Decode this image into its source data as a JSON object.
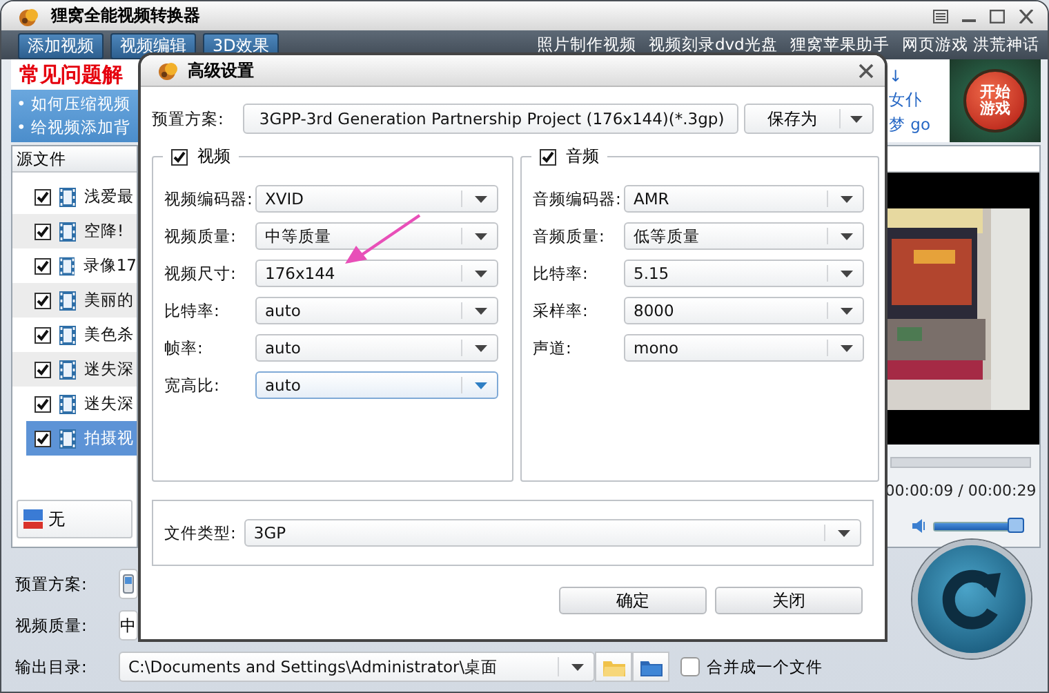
{
  "app": {
    "title": "狸窝全能视频转换器"
  },
  "toolbar": {
    "buttons": [
      "添加视频",
      "视频编辑",
      "3D效果"
    ],
    "links": [
      "照片制作视频",
      "视频刻录dvd光盘",
      "狸窝苹果助手",
      "网页游戏 洪荒神话"
    ]
  },
  "banner": {
    "heading": "常见问题解",
    "lines": [
      "• 如何压缩视频",
      "• 给视频添加背"
    ],
    "side_lines": [
      "↓",
      "女仆",
      "梦 go"
    ],
    "game_badge": "开始游戏"
  },
  "file_list": {
    "header": "源文件",
    "files": [
      {
        "name": "浅爱最",
        "checked": true,
        "selected": false
      },
      {
        "name": "空降!",
        "checked": true,
        "selected": false
      },
      {
        "name": "录像17",
        "checked": true,
        "selected": false
      },
      {
        "name": "美丽的",
        "checked": true,
        "selected": false
      },
      {
        "name": "美色杀",
        "checked": true,
        "selected": false
      },
      {
        "name": "迷失深",
        "checked": true,
        "selected": false
      },
      {
        "name": "迷失深",
        "checked": true,
        "selected": false
      },
      {
        "name": "拍摄视",
        "checked": true,
        "selected": true
      }
    ]
  },
  "subtitle": {
    "value": "无"
  },
  "preview": {
    "progress": {
      "level": 0
    },
    "time": "00:00:09 / 00:00:29",
    "volume": {
      "level": 0.92
    }
  },
  "output": {
    "preset_label": "预置方案:",
    "quality_label": "视频质量:",
    "quality_value": "中",
    "dir_label": "输出目录:",
    "dir_value": "C:\\Documents and Settings\\Administrator\\桌面",
    "merge": {
      "label": "合并成一个文件",
      "checked": false
    }
  },
  "dialog": {
    "title": "高级设置",
    "preset_label": "预置方案:",
    "preset_value": "3GPP-3rd Generation Partnership Project (176x144)(*.3gp)",
    "save_as": "保存为",
    "video": {
      "title": "视频",
      "checked": true,
      "fields": [
        {
          "label": "视频编码器:",
          "value": "XVID",
          "focused": false
        },
        {
          "label": "视频质量:",
          "value": "中等质量",
          "focused": false
        },
        {
          "label": "视频尺寸:",
          "value": "176x144",
          "focused": false
        },
        {
          "label": "比特率:",
          "value": "auto",
          "focused": false
        },
        {
          "label": "帧率:",
          "value": "auto",
          "focused": false
        },
        {
          "label": "宽高比:",
          "value": "auto",
          "focused": true
        }
      ]
    },
    "audio": {
      "title": "音频",
      "checked": true,
      "fields": [
        {
          "label": "音频编码器:",
          "value": "AMR",
          "focused": false
        },
        {
          "label": "音频质量:",
          "value": "低等质量",
          "focused": false
        },
        {
          "label": "比特率:",
          "value": "5.15",
          "focused": false
        },
        {
          "label": "采样率:",
          "value": "8000",
          "focused": false
        },
        {
          "label": "声道:",
          "value": "mono",
          "focused": false
        }
      ]
    },
    "file_type": {
      "label": "文件类型:",
      "value": "3GP"
    },
    "buttons": [
      "确定",
      "关闭"
    ]
  }
}
